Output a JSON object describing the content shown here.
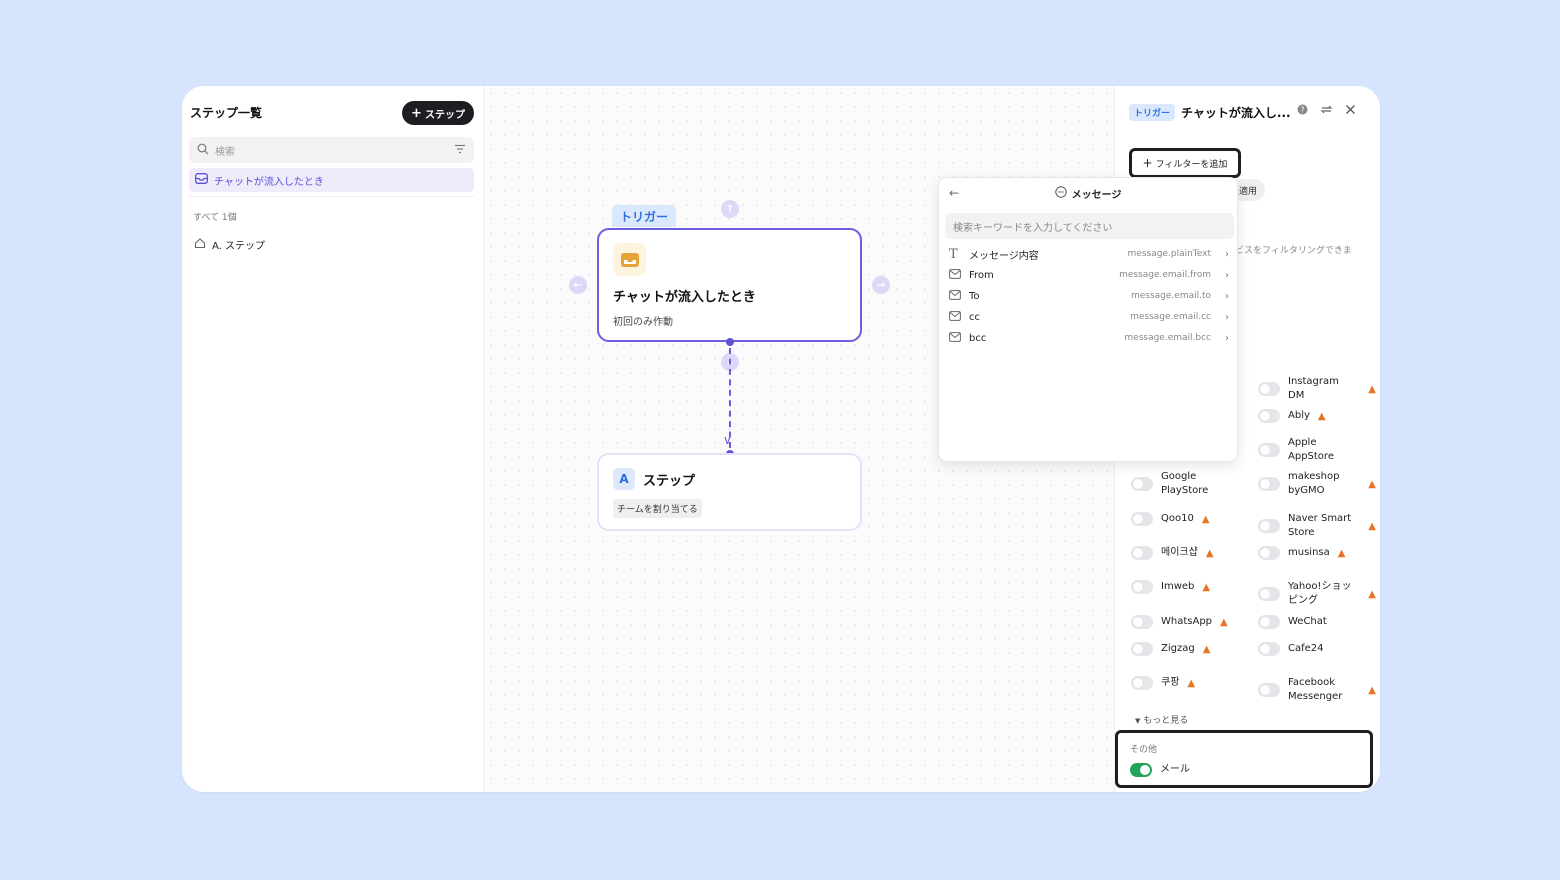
{
  "sidebar": {
    "title": "ステップ一覧",
    "add_step": "ステップ",
    "search_placeholder": "検索",
    "active_item": "チャットが流入したとき",
    "count": "すべて 1個",
    "step_item": "A. ステップ"
  },
  "canvas": {
    "trigger_tag": "トリガー",
    "trigger_title": "チャットが流入したとき",
    "trigger_sub": "初回のみ作動",
    "step_badge": "A",
    "step_title": "ステップ",
    "step_chip": "チームを割り当てる"
  },
  "panel": {
    "tag": "トリガー",
    "title": "チャットが流入し...",
    "add_filter": "フィルターを追加",
    "pill_fragment": "適用",
    "text_fragment": "ビスをフィルタリングできま",
    "channels": [
      {
        "name": "Instagram DM",
        "on": false,
        "warn": true
      },
      {
        "name": "Ably",
        "on": false,
        "warn": true
      },
      {
        "name": "Apple AppStore",
        "on": false,
        "warn": false
      },
      {
        "name": "Google PlayStore",
        "on": false,
        "warn": false
      },
      {
        "name": "makeshop byGMO",
        "on": false,
        "warn": true
      },
      {
        "name": "Qoo10",
        "on": false,
        "warn": true
      },
      {
        "name": "Naver Smart Store",
        "on": false,
        "warn": true
      },
      {
        "name": "메이크샵",
        "on": false,
        "warn": true
      },
      {
        "name": "musinsa",
        "on": false,
        "warn": true
      },
      {
        "name": "Imweb",
        "on": false,
        "warn": true
      },
      {
        "name": "Yahoo!ショッピング",
        "on": false,
        "warn": true
      },
      {
        "name": "WhatsApp",
        "on": false,
        "warn": true
      },
      {
        "name": "WeChat",
        "on": false,
        "warn": false
      },
      {
        "name": "Zigzag",
        "on": false,
        "warn": true
      },
      {
        "name": "Cafe24",
        "on": false,
        "warn": false
      },
      {
        "name": "쿠팡",
        "on": false,
        "warn": true
      },
      {
        "name": "Facebook Messenger",
        "on": false,
        "warn": true
      }
    ],
    "more": "もっと見る",
    "other_label": "その他",
    "mail": {
      "name": "メール",
      "on": true
    }
  },
  "dropdown": {
    "title": "メッセージ",
    "search_placeholder": "検索キーワードを入力してください",
    "rows": [
      {
        "icon": "text-icon",
        "label": "メッセージ内容",
        "value": "message.plainText"
      },
      {
        "icon": "mail-icon",
        "label": "From",
        "value": "message.email.from"
      },
      {
        "icon": "mail-icon",
        "label": "To",
        "value": "message.email.to"
      },
      {
        "icon": "mail-icon",
        "label": "cc",
        "value": "message.email.cc"
      },
      {
        "icon": "mail-icon",
        "label": "bcc",
        "value": "message.email.bcc"
      }
    ]
  },
  "colors": {
    "background": "#d6e4fd",
    "accent": "#6b5fe0",
    "toggle_on": "#22a55a",
    "warning": "#e87425"
  }
}
